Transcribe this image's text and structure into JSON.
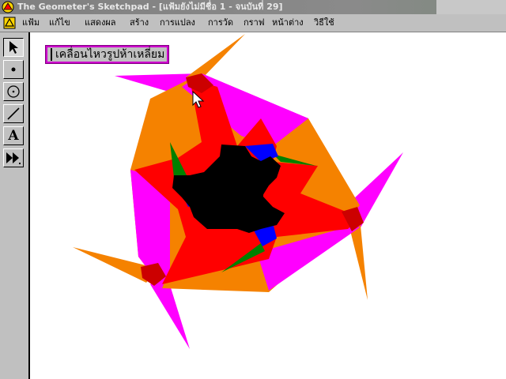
{
  "window": {
    "title": "The Geometer's Sketchpad - [แฟ้มยังไม่มีชื่อ 1 - จนบันที่ 29]"
  },
  "menu": {
    "items": [
      "แฟ้ม",
      "แก้ไข",
      "แสดงผล",
      "สร้าง",
      "การแปลง",
      "การวัด",
      "กราฟ",
      "หน้าต่าง",
      "วิธีใช้"
    ]
  },
  "toolbox": {
    "tools": [
      {
        "name": "selection-arrow-tool",
        "icon": "arrow-icon",
        "active": true
      },
      {
        "name": "point-tool",
        "icon": "point-icon"
      },
      {
        "name": "compass-tool",
        "icon": "circle-icon"
      },
      {
        "name": "straightedge-tool",
        "icon": "segment-icon"
      },
      {
        "name": "text-tool",
        "icon": "text-icon",
        "letter": "A"
      },
      {
        "name": "custom-tool",
        "icon": "double-arrow-icon"
      }
    ]
  },
  "canvas": {
    "action_button_label": "เคลื่อนไหวรูปห้าเหลี่ยม"
  },
  "colors": {
    "orange": "#f58200",
    "magenta": "#ff00ff",
    "red": "#ff0000",
    "black": "#000000",
    "blue": "#0000ff",
    "green": "#008000",
    "button_border": "#cc00cc"
  }
}
